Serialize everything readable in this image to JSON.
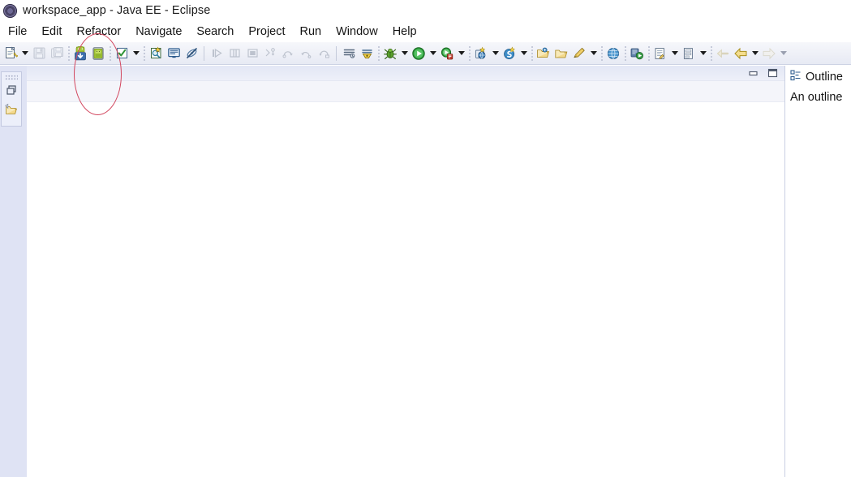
{
  "window": {
    "title": "workspace_app - Java EE - Eclipse",
    "logo_icon": "eclipse-logo-icon"
  },
  "menubar": {
    "items": [
      {
        "label": "File"
      },
      {
        "label": "Edit"
      },
      {
        "label": "Refactor"
      },
      {
        "label": "Navigate"
      },
      {
        "label": "Search"
      },
      {
        "label": "Project"
      },
      {
        "label": "Run"
      },
      {
        "label": "Window"
      },
      {
        "label": "Help"
      }
    ]
  },
  "toolbar": {
    "groups": [
      {
        "name": "file-group",
        "buttons": [
          {
            "icon": "new-wizard-icon",
            "enabled": true,
            "dropdown": true
          },
          {
            "icon": "save-icon",
            "enabled": false,
            "dropdown": false
          },
          {
            "icon": "save-all-icon",
            "enabled": false,
            "dropdown": false
          }
        ]
      },
      {
        "name": "android-group",
        "buttons": [
          {
            "icon": "android-sdk-manager-icon",
            "enabled": true,
            "dropdown": false
          },
          {
            "icon": "android-virtual-device-manager-icon",
            "enabled": true,
            "dropdown": false
          }
        ]
      },
      {
        "name": "validate-group",
        "buttons": [
          {
            "icon": "check-validate-icon",
            "enabled": true,
            "dropdown": true
          }
        ]
      },
      {
        "name": "search-group",
        "buttons": [
          {
            "icon": "new-search-icon",
            "enabled": true,
            "dropdown": false
          },
          {
            "icon": "open-console-icon",
            "enabled": true,
            "dropdown": false
          },
          {
            "icon": "skip-breakpoints-icon",
            "enabled": true,
            "dropdown": false
          }
        ]
      },
      {
        "name": "step-group",
        "buttons": [
          {
            "icon": "resume-icon",
            "enabled": false,
            "dropdown": false
          },
          {
            "icon": "suspend-icon",
            "enabled": false,
            "dropdown": false
          },
          {
            "icon": "terminate-icon",
            "enabled": false,
            "dropdown": false
          },
          {
            "icon": "step-into-icon",
            "enabled": false,
            "dropdown": false
          },
          {
            "icon": "step-over-icon",
            "enabled": false,
            "dropdown": false
          },
          {
            "icon": "step-return-icon",
            "enabled": false,
            "dropdown": false
          },
          {
            "icon": "drop-to-frame-icon",
            "enabled": false,
            "dropdown": false
          }
        ]
      },
      {
        "name": "task-group",
        "buttons": [
          {
            "icon": "activate-task-icon",
            "enabled": true,
            "dropdown": false
          },
          {
            "icon": "deactivate-task-icon",
            "enabled": true,
            "dropdown": false
          }
        ]
      },
      {
        "name": "launch-group",
        "buttons": [
          {
            "icon": "debug-icon",
            "enabled": true,
            "dropdown": true
          },
          {
            "icon": "run-icon",
            "enabled": true,
            "dropdown": true
          },
          {
            "icon": "run-external-tools-icon",
            "enabled": true,
            "dropdown": true
          }
        ]
      },
      {
        "name": "server-group",
        "buttons": [
          {
            "icon": "new-server-icon",
            "enabled": true,
            "dropdown": true
          },
          {
            "icon": "new-java-ee-artifact-icon",
            "enabled": true,
            "dropdown": true
          }
        ]
      },
      {
        "name": "open-group",
        "buttons": [
          {
            "icon": "open-type-icon",
            "enabled": true,
            "dropdown": false
          },
          {
            "icon": "open-task-icon",
            "enabled": true,
            "dropdown": false
          },
          {
            "icon": "new-annotation-icon",
            "enabled": true,
            "dropdown": true
          }
        ]
      },
      {
        "name": "web-group",
        "buttons": [
          {
            "icon": "open-web-browser-icon",
            "enabled": true,
            "dropdown": false
          }
        ]
      },
      {
        "name": "run-android-group",
        "buttons": [
          {
            "icon": "run-android-icon",
            "enabled": true,
            "dropdown": false
          }
        ]
      },
      {
        "name": "perspective-group",
        "buttons": [
          {
            "icon": "new-java-class-icon",
            "enabled": true,
            "dropdown": true
          },
          {
            "icon": "new-java-package-icon",
            "enabled": true,
            "dropdown": true
          }
        ]
      },
      {
        "name": "history-group",
        "buttons": [
          {
            "icon": "previous-annotation-icon",
            "enabled": false,
            "dropdown": false
          },
          {
            "icon": "back-icon",
            "enabled": true,
            "dropdown": true
          },
          {
            "icon": "forward-icon",
            "enabled": false,
            "dropdown": true
          }
        ]
      }
    ]
  },
  "left_rail": {
    "name": "fast-view-bar",
    "buttons": [
      {
        "icon": "restore-view-icon"
      },
      {
        "icon": "project-explorer-icon"
      }
    ]
  },
  "editor_area": {
    "minimize_icon": "minimize-icon",
    "maximize_icon": "maximize-icon"
  },
  "outline_panel": {
    "tab_icon": "outline-view-icon",
    "tab_label": "Outline",
    "message": "An outline"
  },
  "annotation": {
    "name": "red-highlight-ellipse",
    "color": "#d2465e",
    "targets": [
      "android-sdk-manager-icon",
      "android-virtual-device-manager-icon"
    ]
  }
}
